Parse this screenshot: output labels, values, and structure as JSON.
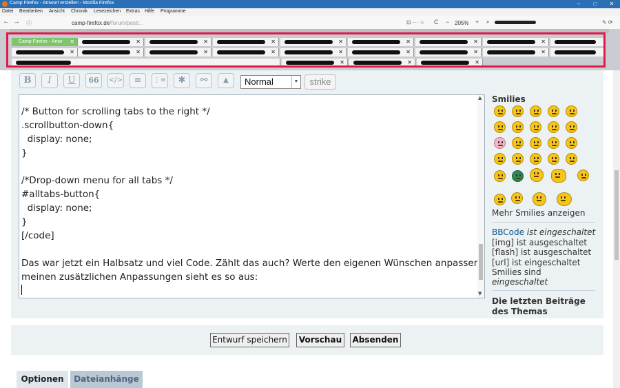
{
  "window": {
    "title": "Camp Firefox - Antwort erstellen - Mozilla Firefox",
    "minimize": "–",
    "maximize": "□",
    "close": "✕"
  },
  "menu": [
    "Datei",
    "Bearbeiten",
    "Ansicht",
    "Chronik",
    "Lesezeichen",
    "Extras",
    "Hilfe",
    "Programme"
  ],
  "navbar": {
    "back": "←",
    "forward": "→",
    "url_host": "camp-firefox.de",
    "url_path": "/forum/posti...",
    "page_actions": "⊡ ··· ☆",
    "reload": "C",
    "zoom_minus": "−",
    "zoom": "205%",
    "zoom_plus": "+",
    "search_icon": "⌕",
    "tools": "✎ ⟳"
  },
  "tabs": {
    "active_label": "Camp Firefox - Antw",
    "close": "✕"
  },
  "editor_toolbar": {
    "bold": "B",
    "italic": "I",
    "underline": "U",
    "quote": "66",
    "code": "</>",
    "list": "≡",
    "numlist": "⋮≡",
    "star": "✱",
    "link": "⚯",
    "color": "▲",
    "font_size": "Normal",
    "strike": "strike"
  },
  "editor": {
    "lines": [
      "/* Button for scrolling tabs to the right */",
      ".scrollbutton-down{",
      "  display: none;",
      "}",
      "",
      "/*Drop-down menu for all tabs */",
      "#alltabs-button{",
      "  display: none;",
      "}",
      "[/code]",
      "",
      "Das war jetzt ein Halbsatz und viel Code. Zählt das auch? Werte den eigenen Wünschen anpassen. Mit",
      "meinen zusätzlichen Anpassungen sieht es so aus:"
    ]
  },
  "sidebar": {
    "smilies_title": "Smilies",
    "more_smilies": "Mehr Smilies anzeigen",
    "bbcode_link": "BBCode",
    "bbcode_status": " ist eingeschaltet",
    "img_status": "[img] ist ausgeschaltet",
    "flash_status": "[flash] ist ausgeschaltet",
    "url_status": "[url] ist eingeschaltet",
    "smilies_status_1": "Smilies sind",
    "smilies_status_2": "eingeschaltet",
    "recent_posts": "Die letzten Beiträge des Themas"
  },
  "actions": {
    "draft": "Entwurf speichern",
    "preview": "Vorschau",
    "submit": "Absenden"
  },
  "panel_tabs": {
    "options": "Optionen",
    "attachments": "Dateianhänge"
  },
  "colors": {
    "highlight": "#e2184a",
    "active_tab": "#7fc46a",
    "link": "#105289"
  }
}
